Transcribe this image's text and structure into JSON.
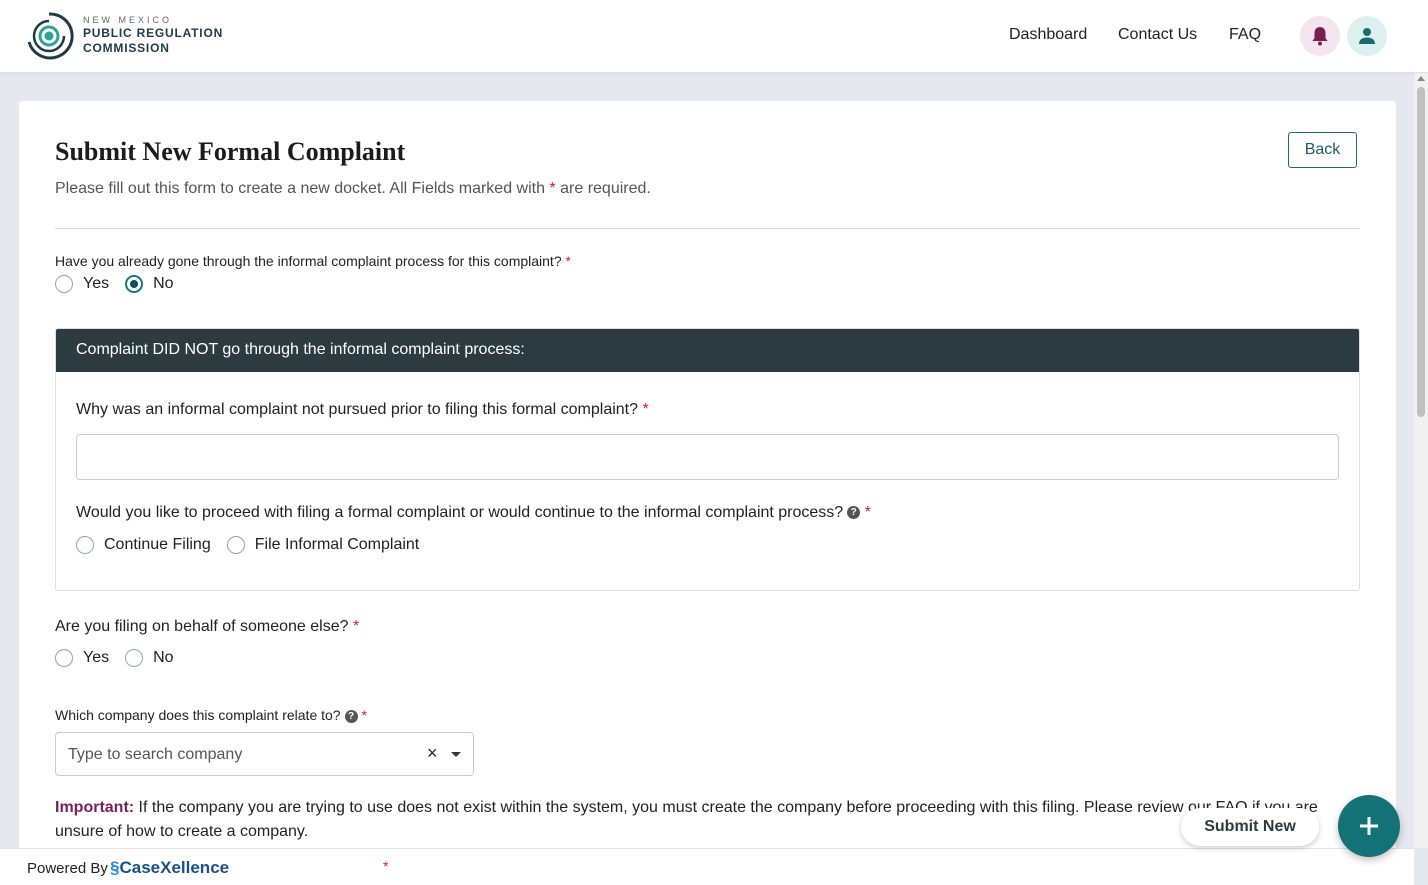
{
  "header": {
    "logo": {
      "line1": "NEW MEXICO",
      "line2": "PUBLIC REGULATION",
      "line3": "COMMISSION"
    },
    "nav": {
      "dashboard": "Dashboard",
      "contact": "Contact Us",
      "faq": "FAQ"
    },
    "icons": {
      "bell": "bell-icon",
      "user": "user-icon"
    },
    "colors": {
      "bell_bg": "#f4e4ee",
      "bell_icon": "#7a1f52",
      "user_bg": "#dcf0f0",
      "user_icon": "#1a6b6b"
    }
  },
  "form": {
    "title": "Submit New Formal Complaint",
    "subtitle_prefix": "Please fill out this form to create a new docket. All Fields marked with ",
    "required_mark": "*",
    "subtitle_suffix": " are required.",
    "back_label": "Back",
    "q1": {
      "text": "Have you already gone through the informal complaint process for this complaint?",
      "options": [
        "Yes",
        "No"
      ],
      "selected": "No"
    },
    "panel": {
      "heading": "Complaint DID NOT go through the informal complaint process:",
      "q_reason": {
        "text": "Why was an informal complaint not pursued prior to filing this formal complaint?",
        "value": ""
      },
      "q_proceed": {
        "text": "Would you like to proceed with filing a formal complaint or would continue to the informal complaint process?",
        "options": [
          "Continue Filing",
          "File Informal Complaint"
        ],
        "selected": null
      }
    },
    "q_behalf": {
      "text": "Are you filing on behalf of someone else?",
      "options": [
        "Yes",
        "No"
      ],
      "selected": null
    },
    "q_company": {
      "text": "Which company does this complaint relate to?",
      "placeholder": "Type to search company",
      "clear": "×"
    },
    "important": {
      "label": "Important:",
      "text": " If the company you are trying to use does not exist within the system, you must create the company before proceeding with this filing. Please review our FAQ if you are unsure of how to create a company."
    }
  },
  "footer": {
    "powered_by": "Powered By",
    "brand": "CaseXellence",
    "star": "*"
  },
  "fab": {
    "label": "Submit New",
    "icon": "plus-icon"
  },
  "colors": {
    "accent": "#137276",
    "panel_header": "#2b3b3f",
    "required": "#c8232c",
    "important": "#7a1f52"
  }
}
